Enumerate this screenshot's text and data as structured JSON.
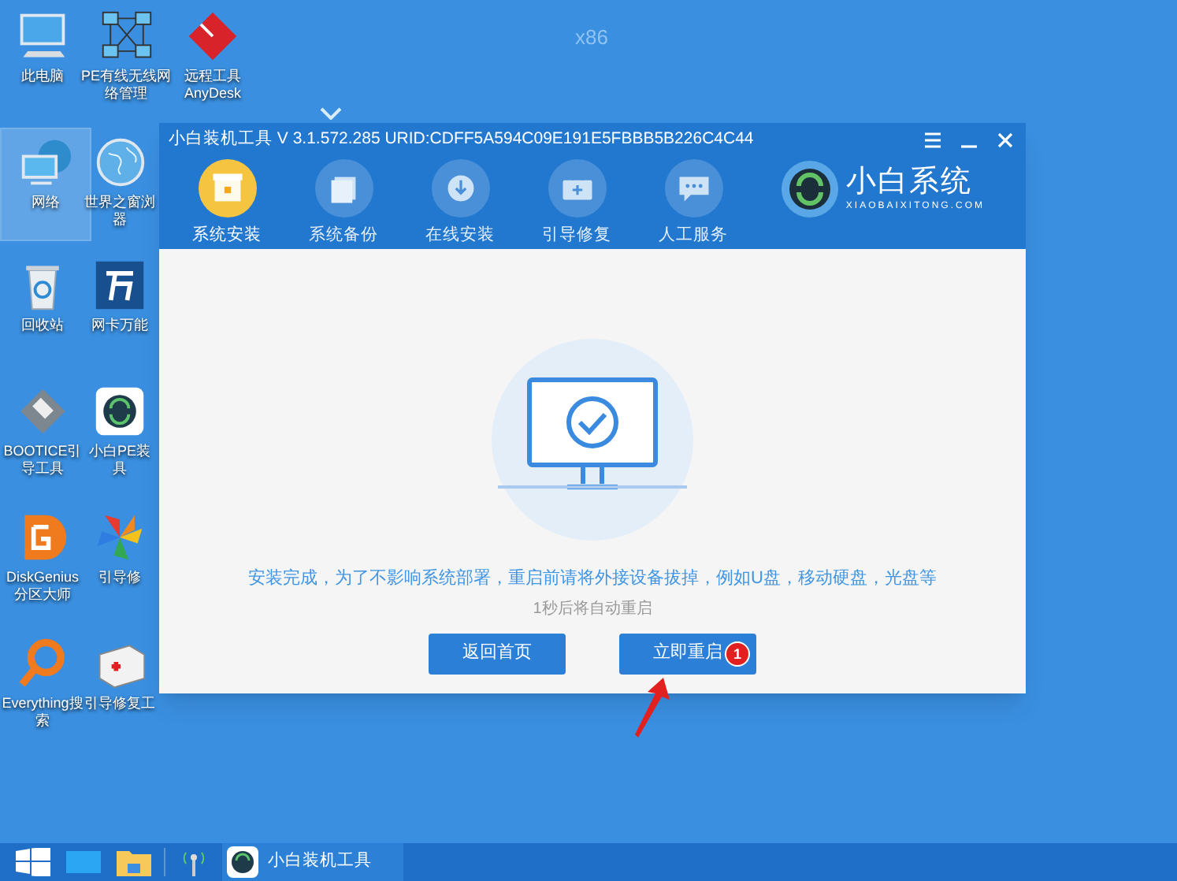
{
  "desktop": {
    "arch_label": "x86",
    "icons": [
      {
        "kind": "monitor",
        "lines": [
          "此电脑"
        ],
        "selected": false
      },
      {
        "kind": "network-map",
        "lines": [
          "PE有线无线网",
          "络管理"
        ],
        "selected": false
      },
      {
        "kind": "diamond",
        "lines": [
          "远程工具",
          "AnyDesk"
        ],
        "selected": false
      },
      {
        "kind": "globe-monitor",
        "lines": [
          "网络"
        ],
        "selected": true
      },
      {
        "kind": "globe",
        "lines": [
          "世界之窗浏",
          "器"
        ],
        "selected": false
      },
      {
        "kind": "recycle",
        "lines": [
          "回收站"
        ],
        "selected": false
      },
      {
        "kind": "wan",
        "lines": [
          "网卡万能"
        ],
        "selected": false
      },
      {
        "kind": "floppy",
        "lines": [
          "BOOTICE引",
          "导工具"
        ],
        "selected": false
      },
      {
        "kind": "app",
        "lines": [
          "小白PE装",
          "具"
        ],
        "selected": false
      },
      {
        "kind": "disk",
        "lines": [
          "DiskGenius",
          "分区大师"
        ],
        "selected": false
      },
      {
        "kind": "pinwheel",
        "lines": [
          "引导修"
        ],
        "selected": false
      },
      {
        "kind": "search",
        "lines": [
          "Everything搜",
          "索"
        ],
        "selected": false
      },
      {
        "kind": "kit",
        "lines": [
          "引导修复工"
        ],
        "selected": false
      }
    ]
  },
  "window": {
    "title": "小白装机工具 V 3.1.572.285 URID:CDFF5A594C09E191E5FBBB5B226C4C44",
    "tabs": [
      {
        "label": "系统安装",
        "selected": true
      },
      {
        "label": "系统备份",
        "selected": false
      },
      {
        "label": "在线安装",
        "selected": false
      },
      {
        "label": "引导修复",
        "selected": false
      },
      {
        "label": "人工服务",
        "selected": false
      }
    ],
    "brand": {
      "name": "小白系统",
      "url": "XIAOBAIXITONG.COM"
    },
    "message": "安装完成，为了不影响系统部署，重启前请将外接设备拔掉，例如U盘，移动硬盘，光盘等",
    "countdown": "1秒后将自动重启",
    "buttons": [
      {
        "label": "返回首页"
      },
      {
        "label": "立即重启",
        "badge": "1"
      }
    ]
  },
  "taskbar": {
    "items": [
      {
        "label": "小白装机工具"
      }
    ]
  }
}
